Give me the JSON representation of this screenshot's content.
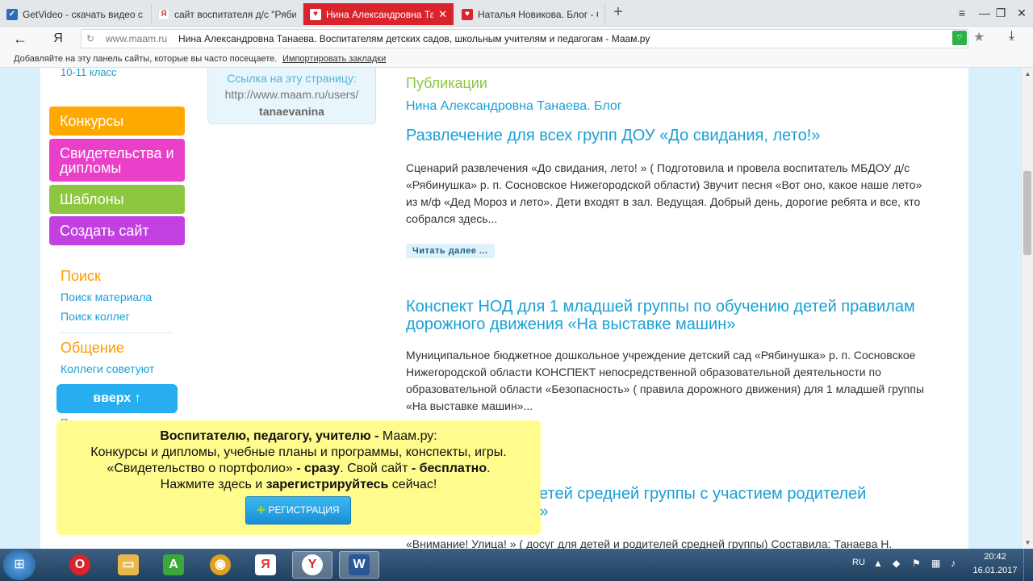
{
  "browser": {
    "tabs": [
      {
        "title": "GetVideo - скачать видео с",
        "icon": "getvideo-icon",
        "icon_char": "✓",
        "icon_color": "#2a6ebb"
      },
      {
        "title": "сайт воспитателя д/с \"Рябин",
        "icon": "yandex-icon",
        "icon_char": "Я",
        "icon_color": "#e33"
      },
      {
        "title": "Нина Александровна Танаева. Та",
        "icon": "maam-heart-icon",
        "icon_char": "♥",
        "icon_color": "#ffffff",
        "active": true
      },
      {
        "title": "Наталья Новикова. Блог - С",
        "icon": "maam-heart-icon",
        "icon_char": "♥",
        "icon_color": "#d9232d"
      }
    ],
    "new_tab": "+",
    "window_controls": {
      "menu": "≡",
      "minimize": "—",
      "restore": "❐",
      "close": "✕"
    },
    "back": "←",
    "logo": "Я",
    "reload": "↻",
    "url_domain": "www.maam.ru",
    "url_title": "Нина Александровна Танаева. Воспитателям детских садов, школьным учителям и педагогам - Маам.ру",
    "bookmarks_hint": "Добавляйте на эту панель сайты, которые вы часто посещаете.",
    "bookmarks_import": "Импортировать закладки"
  },
  "sidebar": {
    "top_link": "10-11 класс",
    "menu": {
      "contests": "Конкурсы",
      "certificates": "Свидетельства и дипломы",
      "templates": "Шаблоны",
      "create_site": "Создать сайт"
    },
    "search_heading": "Поиск",
    "search_material": "Поиск материала",
    "search_colleagues": "Поиск коллег",
    "communication_heading": "Общение",
    "colleagues_advise": "Коллеги советуют",
    "up_button": "вверх ↑",
    "box2_text": "П"
  },
  "link_box": {
    "label": "Ссылка на эту страницу:",
    "url": "http://www.maam.ru/users/",
    "user": "tanaevanina"
  },
  "content": {
    "heading": "Публикации",
    "blog_title": "Нина Александровна Танаева. Блог",
    "articles": [
      {
        "title": "Развлечение для всех групп ДОУ «До свидания, лето!»",
        "text": "Сценарий развлечения «До свидания, лето! » ( Подготовила и провела воспитатель МБДОУ д/с «Рябинушка» р. п. Сосновское Нижегородской области) Звучит песня «Вот оно, какое наше лето» из м/ф «Дед Мороз и лето». Дети входят в зал. Ведущая. Добрый день, дорогие ребята и все, кто собрался здесь..."
      },
      {
        "title": "Конспект НОД для 1 младшей группы по обучению детей правилам дорожного движения «На выставке машин»",
        "text": "Муниципальное бюджетное дошкольное учреждение детский сад «Рябинушка» р. п. Сосновское Нижегородской области КОНСПЕКТ непосредственной образовательной деятельности по образовательной области «Безопасность» ( правила дорожного движения) для 1 младшей группы «На выставке машин»..."
      },
      {
        "title": "...я детей средней группы с участием родителей ...да!»",
        "title_line1": "я детей средней группы с участием родителей",
        "title_line2": "да!»",
        "text": "«Внимание! Улица! » ( досуг для детей и родителей средней группы) Составила: Танаева Н."
      }
    ],
    "read_more": "Читать далее ..."
  },
  "promo": {
    "line1_bold": "Воспитателю, педагогу, учителю -",
    "line1_rest": " Маам.ру:",
    "line2": "Конкурсы и дипломы, учебные планы и программы, конспекты, игры.",
    "line3_a": "«Свидетельство о портфолио»",
    "line3_b": " - сразу",
    "line3_c": ". Свой сайт ",
    "line3_d": "- бесплатно",
    "line3_e": ".",
    "line4_a": "Нажмите здесь и ",
    "line4_b": "зарегистрируйтесь",
    "line4_c": " сейчас!",
    "register_button": "РЕГИСТРАЦИЯ"
  },
  "taskbar": {
    "start": "⊞",
    "apps": [
      {
        "name": "opera-icon",
        "char": "O",
        "color": "#d9232d"
      },
      {
        "name": "file-explorer-icon",
        "char": "▭",
        "color": "#e8b84a"
      },
      {
        "name": "green-a-app-icon",
        "char": "A",
        "color": "#3aa83a"
      },
      {
        "name": "chrome-icon",
        "char": "◉",
        "color": "#e0a020"
      },
      {
        "name": "yandex-app-icon",
        "char": "Я",
        "color": "#e33"
      },
      {
        "name": "yandex-browser-icon",
        "char": "Y",
        "color": "#d9232d",
        "active": true
      },
      {
        "name": "word-icon",
        "char": "W",
        "color": "#2b5797",
        "active": true
      }
    ],
    "lang": "RU",
    "time": "20:42",
    "date": "16.01.2017"
  },
  "colors": {
    "accent_blue": "#1a9fd6",
    "orange": "#ffa800",
    "pink": "#ea3fc8",
    "green": "#8dc63f",
    "purple": "#c23fe0",
    "popup_yellow": "#fffb8c",
    "page_bg": "#d7f0fb"
  }
}
